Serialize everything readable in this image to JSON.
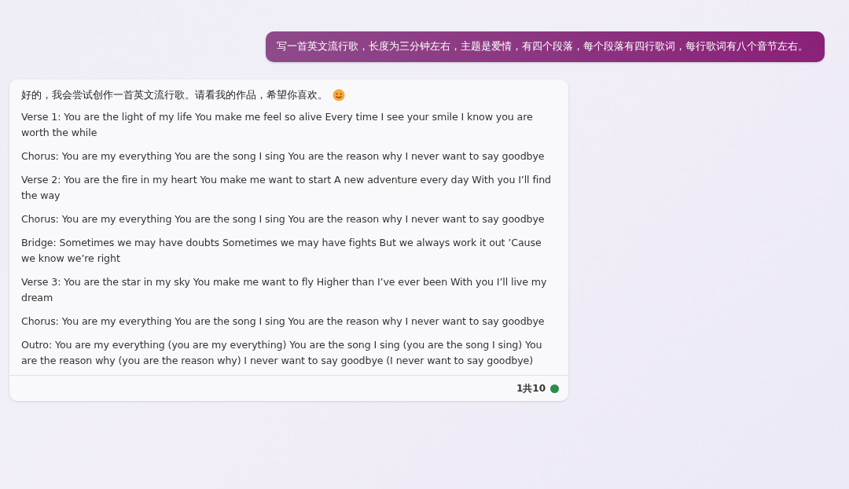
{
  "user_message": {
    "text": "写一首英文流行歌，长度为三分钟左右，主题是爱情，有四个段落，每个段落有四行歌词，每行歌词有八个音节左右。"
  },
  "reply": {
    "intro": "好的，我会尝试创作一首英文流行歌。请看我的作品，希望你喜欢。",
    "paragraphs": [
      "Verse 1: You are the light of my life You make me feel so alive Every time I see your smile I know you are worth the while",
      "Chorus: You are my everything You are the song I sing You are the reason why I never want to say goodbye",
      "Verse 2: You are the fire in my heart You make me want to start A new adventure every day With you I’ll find the way",
      "Chorus: You are my everything You are the song I sing You are the reason why I never want to say goodbye",
      "Bridge: Sometimes we may have doubts Sometimes we may have fights But we always work it out ’Cause we know we’re right",
      "Verse 3: You are the star in my sky You make me want to fly Higher than I’ve ever been With you I’ll live my dream",
      "Chorus: You are my everything You are the song I sing You are the reason why I never want to say goodbye",
      "Outro: You are my everything (you are my everything) You are the song I sing (you are the song I sing) You are the reason why (you are the reason why) I never want to say goodbye (I never want to say goodbye)"
    ],
    "counter": "1共10"
  }
}
